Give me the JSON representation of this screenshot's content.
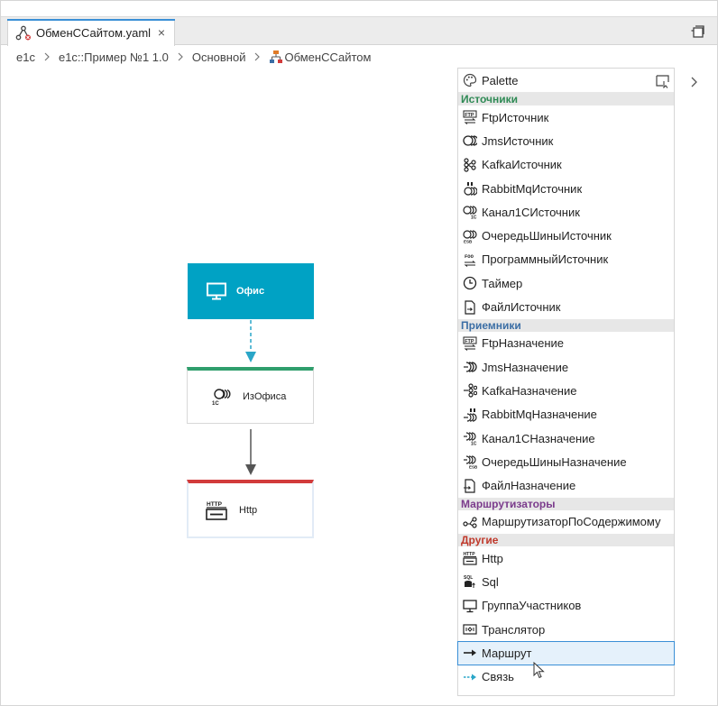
{
  "tab": {
    "title": "ОбменССайтом.yaml",
    "close": "×"
  },
  "breadcrumb": [
    "e1c",
    "e1c::Пример №1 1.0",
    "Основной",
    "ОбменССайтом"
  ],
  "diagram": {
    "nodes": [
      {
        "label": "Офис"
      },
      {
        "label": "ИзОфиса"
      },
      {
        "label": "Http"
      }
    ]
  },
  "palette": {
    "title": "Palette",
    "categories": [
      {
        "name": "Источники",
        "color": "#2f8a55",
        "items": [
          "FtpИсточник",
          "JmsИсточник",
          "KafkaИсточник",
          "RabbitMqИсточник",
          "Канал1СИсточник",
          "ОчередьШиныИсточник",
          "ПрограммныйИсточник",
          "Таймер",
          "ФайлИсточник"
        ]
      },
      {
        "name": "Приемники",
        "color": "#3b6ea5",
        "items": [
          "FtpНазначение",
          "JmsНазначение",
          "KafkaНазначение",
          "RabbitMqНазначение",
          "Канал1СНазначение",
          "ОчередьШиныНазначение",
          "ФайлНазначение"
        ]
      },
      {
        "name": "Маршрутизаторы",
        "color": "#7b3c8c",
        "items": [
          "МаршрутизаторПоСодержимому"
        ]
      },
      {
        "name": "Другие",
        "color": "#c0392b",
        "items": [
          "Http",
          "Sql",
          "ГруппаУчастников",
          "Транслятор",
          "Маршрут",
          "Связь"
        ]
      }
    ],
    "selected_item": "Маршрут"
  },
  "colors": {
    "accent": "#3a8fd6",
    "office": "#00a2c4",
    "link": "#2aa6c8",
    "source_bar": "#2f9e6c",
    "http_bar": "#d23b3b"
  }
}
